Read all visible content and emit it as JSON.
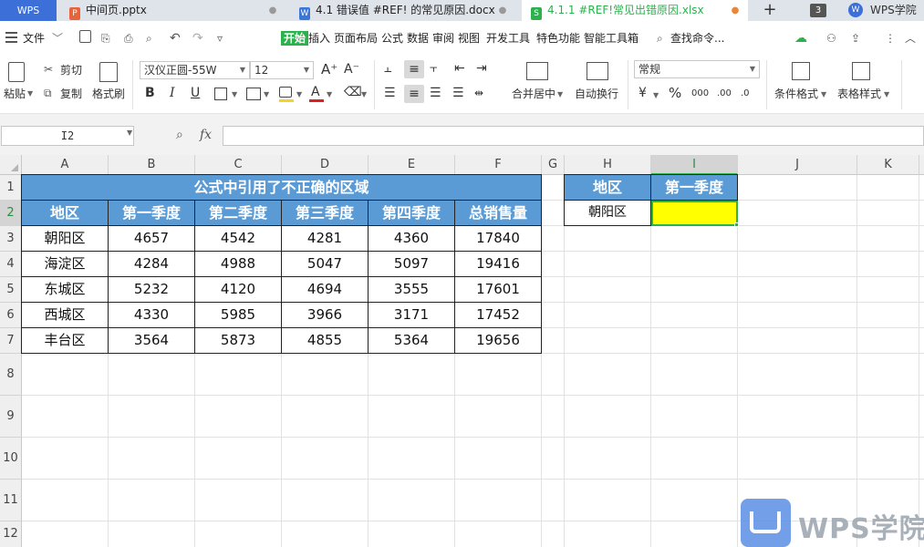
{
  "tabs": {
    "logo": "WPS",
    "doc1": "中间页.pptx",
    "doc2": "4.1 错误值 #REF! 的常见原因.docx",
    "doc3": "4.1.1 #REF!常见出错原因.xlsx",
    "count": "3",
    "account": "WPS学院"
  },
  "menu": {
    "file": "文件",
    "items": [
      "开始",
      "插入",
      "页面布局",
      "公式",
      "数据",
      "审阅",
      "视图",
      "开发工具",
      "特色功能",
      "智能工具箱"
    ],
    "search": "查找命令..."
  },
  "ribbon": {
    "paste": "粘贴",
    "cut": "剪切",
    "copy": "复制",
    "format_painter": "格式刷",
    "font_name": "汉仪正圆-55W",
    "font_size": "12",
    "merge_center": "合并居中",
    "wrap_text": "自动换行",
    "number_format": "常规",
    "cond_format": "条件格式",
    "table_style": "表格样式"
  },
  "formula_bar": {
    "name_box": "I2",
    "fx": "fx",
    "formula": ""
  },
  "columns": [
    "A",
    "B",
    "C",
    "D",
    "E",
    "F",
    "G",
    "H",
    "I",
    "J",
    "K"
  ],
  "rows": [
    "1",
    "2",
    "3",
    "4",
    "5",
    "6",
    "7",
    "8",
    "9",
    "10",
    "11",
    "12"
  ],
  "sheet": {
    "title": "公式中引用了不正确的区域",
    "headers": [
      "地区",
      "第一季度",
      "第二季度",
      "第三季度",
      "第四季度",
      "总销售量"
    ],
    "data": [
      [
        "朝阳区",
        "4657",
        "4542",
        "4281",
        "4360",
        "17840"
      ],
      [
        "海淀区",
        "4284",
        "4988",
        "5047",
        "5097",
        "19416"
      ],
      [
        "东城区",
        "5232",
        "4120",
        "4694",
        "3555",
        "17601"
      ],
      [
        "西城区",
        "4330",
        "5985",
        "3966",
        "3171",
        "17452"
      ],
      [
        "丰台区",
        "3564",
        "5873",
        "4855",
        "5364",
        "19656"
      ]
    ],
    "lookup_headers": [
      "地区",
      "第一季度"
    ],
    "lookup_region": "朝阳区",
    "lookup_value": ""
  },
  "watermark": "WPS学院",
  "colors": {
    "header_blue": "#5b9bd5",
    "selection_yellow": "#ffff00",
    "active_green": "#2bb24c"
  }
}
